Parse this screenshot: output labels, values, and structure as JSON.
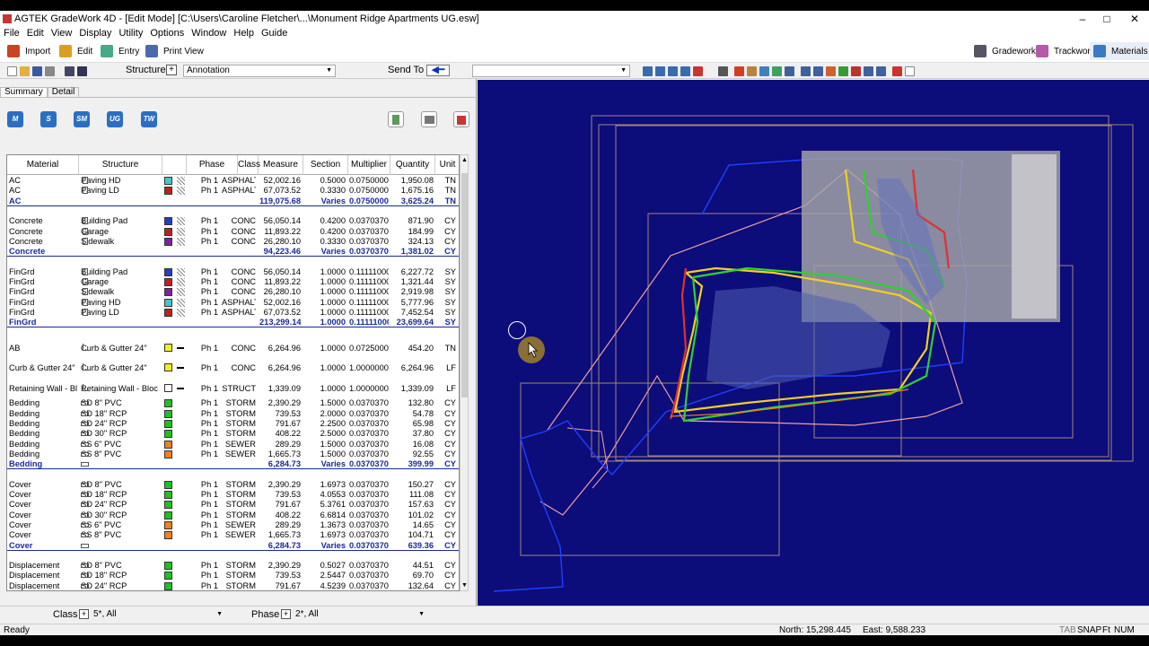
{
  "window": {
    "title": "AGTEK GradeWork 4D - [Edit Mode]  [C:\\Users\\Caroline Fletcher\\...\\Monument Ridge Apartments UG.esw]",
    "minimize": "–",
    "maximize": "□",
    "close": "✕"
  },
  "menu": [
    "File",
    "Edit",
    "View",
    "Display",
    "Utility",
    "Options",
    "Window",
    "Help",
    "Guide"
  ],
  "ribbon": {
    "import": "Import",
    "edit": "Edit",
    "entry": "Entry",
    "print_view": "Print View",
    "gradework": "Gradework",
    "trackwork": "Trackwork",
    "materials": "Materials"
  },
  "toolbar": {
    "structure_label": "Structure",
    "structure_value": "Annotation",
    "send_to_label": "Send To",
    "send_to_value": ""
  },
  "tabs": [
    "Summary",
    "Detail"
  ],
  "panel_buttons": [
    "M",
    "S",
    "SM",
    "UG",
    "TW"
  ],
  "grid": {
    "headers": [
      "Material",
      "Structure",
      "Phase",
      "Class",
      "Measure",
      "Section",
      "Multiplier",
      "Quantity",
      "Unit"
    ],
    "rows": [
      {
        "t": "d",
        "m": "AC",
        "s": "Paving HD",
        "sw": "#40c8c8",
        "si": "box",
        "p": "Ph 1",
        "c": "ASPHALT",
        "me": "52,002.16",
        "se": "0.5000",
        "mu": "0.07500000",
        "q": "1,950.08",
        "u": "TN"
      },
      {
        "t": "d",
        "m": "AC",
        "s": "Paving LD",
        "sw": "#c02020",
        "si": "box",
        "p": "Ph 1",
        "c": "ASPHALT",
        "me": "67,073.52",
        "se": "0.3330",
        "mu": "0.07500000",
        "q": "1,675.16",
        "u": "TN"
      },
      {
        "t": "t",
        "m": "AC",
        "me": "119,075.68",
        "se": "Varies",
        "mu": "0.07500000",
        "q": "3,625.24",
        "u": "TN"
      },
      {
        "t": "b"
      },
      {
        "t": "d",
        "m": "Concrete",
        "s": "Building Pad",
        "sw": "#2040c0",
        "si": "box",
        "p": "Ph 1",
        "c": "CONC",
        "me": "56,050.14",
        "se": "0.4200",
        "mu": "0.03703700",
        "q": "871.90",
        "u": "CY"
      },
      {
        "t": "d",
        "m": "Concrete",
        "s": "Garage",
        "sw": "#c02020",
        "si": "box",
        "p": "Ph 1",
        "c": "CONC",
        "me": "11,893.22",
        "se": "0.4200",
        "mu": "0.03703700",
        "q": "184.99",
        "u": "CY"
      },
      {
        "t": "d",
        "m": "Concrete",
        "s": "Sidewalk",
        "sw": "#8020a0",
        "si": "box",
        "p": "Ph 1",
        "c": "CONC",
        "me": "26,280.10",
        "se": "0.3330",
        "mu": "0.03703700",
        "q": "324.13",
        "u": "CY"
      },
      {
        "t": "t",
        "m": "Concrete",
        "me": "94,223.46",
        "se": "Varies",
        "mu": "0.03703700",
        "q": "1,381.02",
        "u": "CY"
      },
      {
        "t": "b"
      },
      {
        "t": "d",
        "m": "FinGrd",
        "s": "Building Pad",
        "sw": "#2040c0",
        "si": "box",
        "p": "Ph 1",
        "c": "CONC",
        "me": "56,050.14",
        "se": "1.0000",
        "mu": "0.11111000",
        "q": "6,227.72",
        "u": "SY"
      },
      {
        "t": "d",
        "m": "FinGrd",
        "s": "Garage",
        "sw": "#c02020",
        "si": "box",
        "p": "Ph 1",
        "c": "CONC",
        "me": "11,893.22",
        "se": "1.0000",
        "mu": "0.11111000",
        "q": "1,321.44",
        "u": "SY"
      },
      {
        "t": "d",
        "m": "FinGrd",
        "s": "Sidewalk",
        "sw": "#8020a0",
        "si": "box",
        "p": "Ph 1",
        "c": "CONC",
        "me": "26,280.10",
        "se": "1.0000",
        "mu": "0.11111000",
        "q": "2,919.98",
        "u": "SY"
      },
      {
        "t": "d",
        "m": "FinGrd",
        "s": "Paving HD",
        "sw": "#40c8c8",
        "si": "box",
        "p": "Ph 1",
        "c": "ASPHALT",
        "me": "52,002.16",
        "se": "1.0000",
        "mu": "0.11111000",
        "q": "5,777.96",
        "u": "SY"
      },
      {
        "t": "d",
        "m": "FinGrd",
        "s": "Paving LD",
        "sw": "#c02020",
        "si": "box",
        "p": "Ph 1",
        "c": "ASPHALT",
        "me": "67,073.52",
        "se": "1.0000",
        "mu": "0.11111000",
        "q": "7,452.54",
        "u": "SY"
      },
      {
        "t": "t",
        "m": "FinGrd",
        "me": "213,299.14",
        "se": "1.0000",
        "mu": "0.11111000",
        "q": "23,699.64",
        "u": "SY"
      },
      {
        "t": "b"
      },
      {
        "t": "d",
        "tall": true,
        "m": "AB",
        "s": "Curb & Gutter 24\"",
        "sw": "#f0f020",
        "si": "curb",
        "p": "Ph 1",
        "c": "CONC",
        "me": "6,264.96",
        "se": "1.0000",
        "mu": "0.07250000",
        "q": "454.20",
        "u": "TN"
      },
      {
        "t": "d",
        "tall": true,
        "m": "Curb & Gutter 24\"",
        "s": "Curb & Gutter 24\"",
        "sw": "#f0f020",
        "si": "curb",
        "p": "Ph 1",
        "c": "CONC",
        "me": "6,264.96",
        "se": "1.0000",
        "mu": "1.00000000",
        "q": "6,264.96",
        "u": "LF"
      },
      {
        "t": "d",
        "tall": true,
        "m": "Retaining Wall - Bloc",
        "s": "Retaining Wall - Bloc",
        "sw": "#ffffff",
        "si": "curb",
        "p": "Ph 1",
        "c": "STRUCT",
        "me": "1,339.09",
        "se": "1.0000",
        "mu": "1.00000000",
        "q": "1,339.09",
        "u": "LF"
      },
      {
        "t": "d",
        "m": "Bedding",
        "s": "SD 8\" PVC",
        "sw": "#20c020",
        "si": "pipe",
        "p": "Ph 1",
        "c": "STORM",
        "me": "2,390.29",
        "se": "1.5000",
        "mu": "0.03703700",
        "q": "132.80",
        "u": "CY"
      },
      {
        "t": "d",
        "m": "Bedding",
        "s": "SD 18\" RCP",
        "sw": "#20c020",
        "si": "pipe",
        "p": "Ph 1",
        "c": "STORM",
        "me": "739.53",
        "se": "2.0000",
        "mu": "0.03703700",
        "q": "54.78",
        "u": "CY"
      },
      {
        "t": "d",
        "m": "Bedding",
        "s": "SD 24\" RCP",
        "sw": "#20c020",
        "si": "pipe",
        "p": "Ph 1",
        "c": "STORM",
        "me": "791.67",
        "se": "2.2500",
        "mu": "0.03703700",
        "q": "65.98",
        "u": "CY"
      },
      {
        "t": "d",
        "m": "Bedding",
        "s": "SD 30\" RCP",
        "sw": "#20c020",
        "si": "pipe",
        "p": "Ph 1",
        "c": "STORM",
        "me": "408.22",
        "se": "2.5000",
        "mu": "0.03703700",
        "q": "37.80",
        "u": "CY"
      },
      {
        "t": "d",
        "m": "Bedding",
        "s": "SS 6\" PVC",
        "sw": "#f08020",
        "si": "pipe",
        "p": "Ph 1",
        "c": "SEWER",
        "me": "289.29",
        "se": "1.5000",
        "mu": "0.03703700",
        "q": "16.08",
        "u": "CY"
      },
      {
        "t": "d",
        "m": "Bedding",
        "s": "SS 8\" PVC",
        "sw": "#f08020",
        "si": "pipe",
        "p": "Ph 1",
        "c": "SEWER",
        "me": "1,665.73",
        "se": "1.5000",
        "mu": "0.03703700",
        "q": "92.55",
        "u": "CY"
      },
      {
        "t": "t",
        "m": "Bedding",
        "si": "pipe",
        "me": "6,284.73",
        "se": "Varies",
        "mu": "0.03703700",
        "q": "399.99",
        "u": "CY"
      },
      {
        "t": "b"
      },
      {
        "t": "d",
        "m": "Cover",
        "s": "SD 8\" PVC",
        "sw": "#20c020",
        "si": "pipe",
        "p": "Ph 1",
        "c": "STORM",
        "me": "2,390.29",
        "se": "1.6973",
        "mu": "0.03703700",
        "q": "150.27",
        "u": "CY"
      },
      {
        "t": "d",
        "m": "Cover",
        "s": "SD 18\" RCP",
        "sw": "#20c020",
        "si": "pipe",
        "p": "Ph 1",
        "c": "STORM",
        "me": "739.53",
        "se": "4.0553",
        "mu": "0.03703700",
        "q": "111.08",
        "u": "CY"
      },
      {
        "t": "d",
        "m": "Cover",
        "s": "SD 24\" RCP",
        "sw": "#20c020",
        "si": "pipe",
        "p": "Ph 1",
        "c": "STORM",
        "me": "791.67",
        "se": "5.3761",
        "mu": "0.03703700",
        "q": "157.63",
        "u": "CY"
      },
      {
        "t": "d",
        "m": "Cover",
        "s": "SD 30\" RCP",
        "sw": "#20c020",
        "si": "pipe",
        "p": "Ph 1",
        "c": "STORM",
        "me": "408.22",
        "se": "6.6814",
        "mu": "0.03703700",
        "q": "101.02",
        "u": "CY"
      },
      {
        "t": "d",
        "m": "Cover",
        "s": "SS 6\" PVC",
        "sw": "#f08020",
        "si": "pipe",
        "p": "Ph 1",
        "c": "SEWER",
        "me": "289.29",
        "se": "1.3673",
        "mu": "0.03703700",
        "q": "14.65",
        "u": "CY"
      },
      {
        "t": "d",
        "m": "Cover",
        "s": "SS 8\" PVC",
        "sw": "#f08020",
        "si": "pipe",
        "p": "Ph 1",
        "c": "SEWER",
        "me": "1,665.73",
        "se": "1.6973",
        "mu": "0.03703700",
        "q": "104.71",
        "u": "CY"
      },
      {
        "t": "t",
        "m": "Cover",
        "si": "pipe",
        "me": "6,284.73",
        "se": "Varies",
        "mu": "0.03703700",
        "q": "639.36",
        "u": "CY"
      },
      {
        "t": "b"
      },
      {
        "t": "d",
        "m": "Displacement",
        "s": "SD 8\" PVC",
        "sw": "#20c020",
        "si": "pipe",
        "p": "Ph 1",
        "c": "STORM",
        "me": "2,390.29",
        "se": "0.5027",
        "mu": "0.03703700",
        "q": "44.51",
        "u": "CY"
      },
      {
        "t": "d",
        "m": "Displacement",
        "s": "SD 18\" RCP",
        "sw": "#20c020",
        "si": "pipe",
        "p": "Ph 1",
        "c": "STORM",
        "me": "739.53",
        "se": "2.5447",
        "mu": "0.03703700",
        "q": "69.70",
        "u": "CY"
      },
      {
        "t": "d",
        "m": "Displacement",
        "s": "SD 24\" RCP",
        "sw": "#20c020",
        "si": "pipe",
        "p": "Ph 1",
        "c": "STORM",
        "me": "791.67",
        "se": "4.5239",
        "mu": "0.03703700",
        "q": "132.64",
        "u": "CY"
      }
    ]
  },
  "filters": {
    "class_label": "Class",
    "class_value": "5*, All",
    "phase_label": "Phase",
    "phase_value": "2*, All"
  },
  "status": {
    "ready": "Ready",
    "north": "North: 15,298.445",
    "east": "East: 9,588.233",
    "indicators": [
      "TAB",
      "SNAP",
      "Ft",
      "NUM"
    ]
  }
}
